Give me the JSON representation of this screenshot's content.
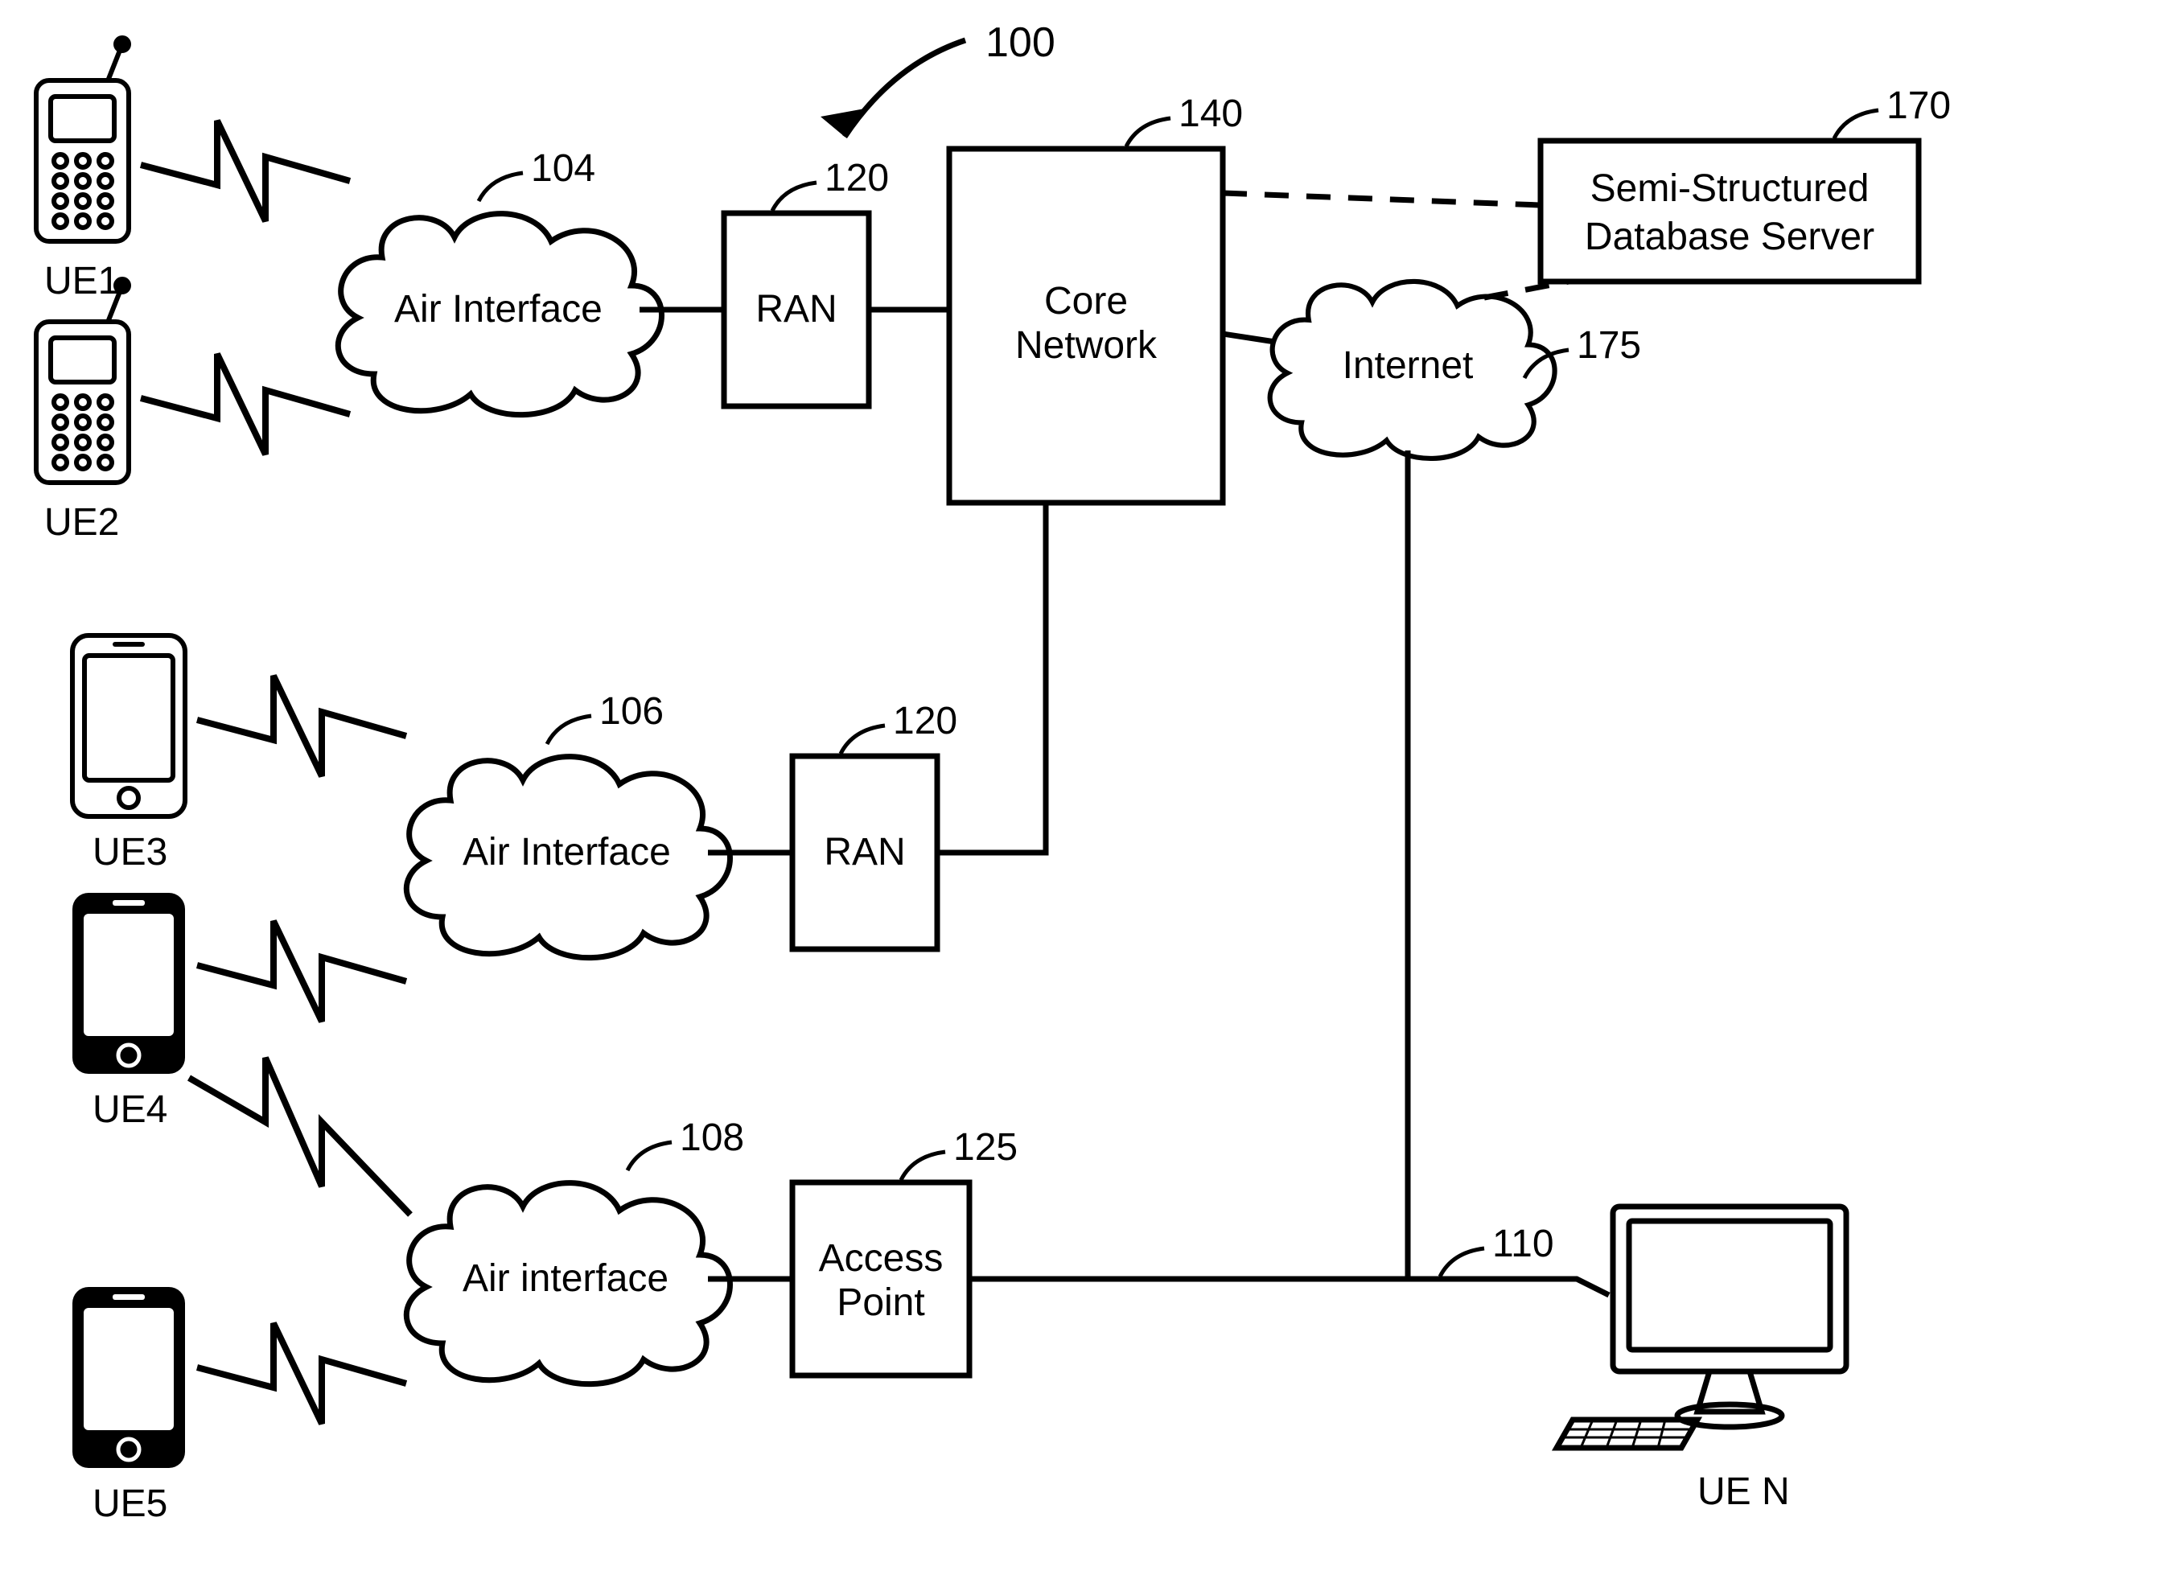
{
  "figure_ref": "100",
  "ue": {
    "ue1": "UE1",
    "ue2": "UE2",
    "ue3": "UE3",
    "ue4": "UE4",
    "ue5": "UE5",
    "uen": "UE N"
  },
  "air_interface": {
    "label_104": "Air Interface",
    "ref_104": "104",
    "label_106": "Air Interface",
    "ref_106": "106",
    "label_108": "Air interface",
    "ref_108": "108"
  },
  "ran": {
    "label_a": "RAN",
    "ref_a": "120",
    "label_b": "RAN",
    "ref_b": "120"
  },
  "access_point": {
    "line1": "Access",
    "line2": "Point",
    "ref": "125"
  },
  "core_network": {
    "line1": "Core",
    "line2": "Network",
    "ref": "140"
  },
  "internet": {
    "label": "Internet",
    "ref": "175"
  },
  "db_server": {
    "line1": "Semi-Structured",
    "line2": "Database Server",
    "ref": "170"
  },
  "wired": {
    "ref": "110"
  }
}
